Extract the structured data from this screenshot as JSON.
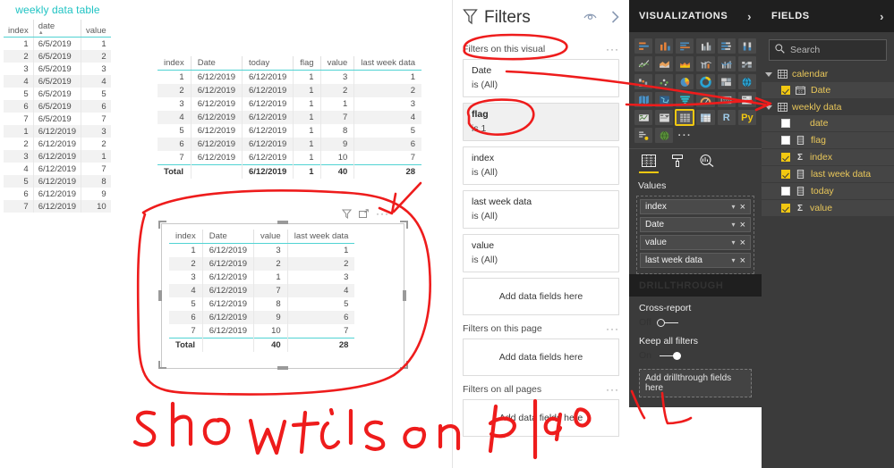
{
  "canvas": {
    "weekly_visual": {
      "title": "weekly data table",
      "columns": [
        "index",
        "date",
        "value"
      ],
      "sorted_column": "date",
      "rows": [
        [
          "1",
          "6/5/2019",
          "1"
        ],
        [
          "2",
          "6/5/2019",
          "2"
        ],
        [
          "3",
          "6/5/2019",
          "3"
        ],
        [
          "4",
          "6/5/2019",
          "4"
        ],
        [
          "5",
          "6/5/2019",
          "5"
        ],
        [
          "6",
          "6/5/2019",
          "6"
        ],
        [
          "7",
          "6/5/2019",
          "7"
        ],
        [
          "1",
          "6/12/2019",
          "3"
        ],
        [
          "2",
          "6/12/2019",
          "2"
        ],
        [
          "3",
          "6/12/2019",
          "1"
        ],
        [
          "4",
          "6/12/2019",
          "7"
        ],
        [
          "5",
          "6/12/2019",
          "8"
        ],
        [
          "6",
          "6/12/2019",
          "9"
        ],
        [
          "7",
          "6/12/2019",
          "10"
        ]
      ]
    },
    "detail_visual": {
      "columns": [
        "index",
        "Date",
        "today",
        "flag",
        "value",
        "last week data"
      ],
      "rows": [
        [
          "1",
          "6/12/2019",
          "6/12/2019",
          "1",
          "3",
          "1"
        ],
        [
          "2",
          "6/12/2019",
          "6/12/2019",
          "1",
          "2",
          "2"
        ],
        [
          "3",
          "6/12/2019",
          "6/12/2019",
          "1",
          "1",
          "3"
        ],
        [
          "4",
          "6/12/2019",
          "6/12/2019",
          "1",
          "7",
          "4"
        ],
        [
          "5",
          "6/12/2019",
          "6/12/2019",
          "1",
          "8",
          "5"
        ],
        [
          "6",
          "6/12/2019",
          "6/12/2019",
          "1",
          "9",
          "6"
        ],
        [
          "7",
          "6/12/2019",
          "6/12/2019",
          "1",
          "10",
          "7"
        ]
      ],
      "total": [
        "Total",
        "",
        "6/12/2019",
        "1",
        "40",
        "28"
      ]
    },
    "selected_visual": {
      "columns": [
        "index",
        "Date",
        "value",
        "last week data"
      ],
      "rows": [
        [
          "1",
          "6/12/2019",
          "3",
          "1"
        ],
        [
          "2",
          "6/12/2019",
          "2",
          "2"
        ],
        [
          "3",
          "6/12/2019",
          "1",
          "3"
        ],
        [
          "4",
          "6/12/2019",
          "7",
          "4"
        ],
        [
          "5",
          "6/12/2019",
          "8",
          "5"
        ],
        [
          "6",
          "6/12/2019",
          "9",
          "6"
        ],
        [
          "7",
          "6/12/2019",
          "10",
          "7"
        ]
      ],
      "total": [
        "Total",
        "",
        "40",
        "28"
      ],
      "toolbar": {
        "filter_icon": "filter-icon",
        "focus_icon": "focus-mode-icon",
        "more_label": "···"
      }
    }
  },
  "filters": {
    "title": "Filters",
    "filter_icon": "funnel-icon",
    "hide_icon": "eye-hide-icon",
    "collapse_icon": "chevron-right-icon",
    "more_label": "···",
    "visual_section": {
      "label": "Filters on this visual",
      "cards": [
        {
          "name": "Date",
          "value": "is (All)",
          "active": false
        },
        {
          "name": "flag",
          "value": "is 1",
          "active": true
        },
        {
          "name": "index",
          "value": "is (All)",
          "active": false
        },
        {
          "name": "last week data",
          "value": "is (All)",
          "active": false
        },
        {
          "name": "value",
          "value": "is (All)",
          "active": false
        }
      ],
      "dropzone": "Add data fields here"
    },
    "page_section": {
      "label": "Filters on this page",
      "dropzone": "Add data fields here"
    },
    "all_pages_section": {
      "label": "Filters on all pages",
      "dropzone": "Add data fields here"
    }
  },
  "visualizations": {
    "title": "VISUALIZATIONS",
    "collapse_icon": "chevron-right-icon",
    "icons": [
      {
        "name": "stacked-bar-chart-icon",
        "selected": false
      },
      {
        "name": "stacked-column-chart-icon",
        "selected": false
      },
      {
        "name": "clustered-bar-chart-icon",
        "selected": false
      },
      {
        "name": "clustered-column-chart-icon",
        "selected": false
      },
      {
        "name": "100-stacked-bar-chart-icon",
        "selected": false
      },
      {
        "name": "100-stacked-column-chart-icon",
        "selected": false
      },
      {
        "name": "line-chart-icon",
        "selected": false
      },
      {
        "name": "area-chart-icon",
        "selected": false
      },
      {
        "name": "stacked-area-chart-icon",
        "selected": false
      },
      {
        "name": "line-stacked-column-chart-icon",
        "selected": false
      },
      {
        "name": "line-clustered-column-chart-icon",
        "selected": false
      },
      {
        "name": "ribbon-chart-icon",
        "selected": false
      },
      {
        "name": "waterfall-chart-icon",
        "selected": false
      },
      {
        "name": "scatter-chart-icon",
        "selected": false
      },
      {
        "name": "pie-chart-icon",
        "selected": false
      },
      {
        "name": "donut-chart-icon",
        "selected": false
      },
      {
        "name": "treemap-icon",
        "selected": false
      },
      {
        "name": "map-icon",
        "selected": false
      },
      {
        "name": "filled-map-icon",
        "selected": false
      },
      {
        "name": "shape-map-icon",
        "selected": false
      },
      {
        "name": "funnel-chart-icon",
        "selected": false
      },
      {
        "name": "gauge-icon",
        "selected": false
      },
      {
        "name": "card-icon",
        "selected": false
      },
      {
        "name": "multi-row-card-icon",
        "selected": false
      },
      {
        "name": "kpi-icon",
        "selected": false
      },
      {
        "name": "slicer-icon",
        "selected": false
      },
      {
        "name": "table-icon",
        "selected": true
      },
      {
        "name": "matrix-icon",
        "selected": false
      },
      {
        "name": "r-script-visual-icon",
        "selected": false,
        "text": "R"
      },
      {
        "name": "python-visual-icon",
        "selected": false,
        "text": "Py"
      },
      {
        "name": "key-influencers-icon",
        "selected": false
      },
      {
        "name": "arcgis-maps-icon",
        "selected": false
      },
      {
        "name": "get-more-visuals-icon",
        "selected": false,
        "text": "···"
      }
    ],
    "tabs": [
      {
        "name": "fields-tab",
        "icon": "fields-grid-icon",
        "active": true
      },
      {
        "name": "format-tab",
        "icon": "paint-roller-icon",
        "active": false
      },
      {
        "name": "analytics-tab",
        "icon": "magnifier-chart-icon",
        "active": false
      }
    ],
    "values_well": {
      "label": "Values",
      "fields": [
        {
          "name": "index",
          "chevron": "▾",
          "remove": "×"
        },
        {
          "name": "Date",
          "chevron": "▾",
          "remove": "×"
        },
        {
          "name": "value",
          "chevron": "▾",
          "remove": "×"
        },
        {
          "name": "last week data",
          "chevron": "▾",
          "remove": "×"
        }
      ]
    }
  },
  "drillthrough": {
    "title": "DRILLTHROUGH",
    "cross_report": {
      "label": "Cross-report",
      "state": "Off",
      "on": false
    },
    "keep_all_filters": {
      "label": "Keep all filters",
      "state": "On",
      "on": true
    },
    "dropzone": "Add drillthrough fields here"
  },
  "fields": {
    "title": "FIELDS",
    "collapse_icon": "chevron-right-icon",
    "search": {
      "placeholder": "Search",
      "value": "",
      "icon": "search-icon"
    },
    "tables": [
      {
        "name": "calendar",
        "expanded": true,
        "fields": [
          {
            "name": "Date",
            "checked": true,
            "type": "date",
            "aggregate": false
          }
        ]
      },
      {
        "name": "weekly data",
        "expanded": true,
        "fields": [
          {
            "name": "date",
            "checked": false,
            "type": "plain",
            "aggregate": false
          },
          {
            "name": "flag",
            "checked": false,
            "type": "column",
            "aggregate": false
          },
          {
            "name": "index",
            "checked": true,
            "type": "sigma",
            "aggregate": true
          },
          {
            "name": "last week data",
            "checked": true,
            "type": "column",
            "aggregate": false
          },
          {
            "name": "today",
            "checked": false,
            "type": "column",
            "aggregate": false
          },
          {
            "name": "value",
            "checked": true,
            "type": "sigma",
            "aggregate": true
          }
        ]
      }
    ]
  },
  "annotations": {
    "handwriting": "show this on report",
    "color": "#ee1c1c",
    "marks": [
      {
        "name": "ellipse-filters-on-this-visual"
      },
      {
        "name": "ellipse-flag-filter"
      },
      {
        "name": "arrow-date-filter-to-fields-date"
      },
      {
        "name": "arrow-to-visual-more-menu"
      },
      {
        "name": "rectangle-around-selected-table"
      },
      {
        "name": "underline-drillthrough"
      }
    ]
  },
  "colors": {
    "accent_teal": "#1fc3c3",
    "panel_dark": "#3b3b3b",
    "panel_header_dark": "#1f1f1f",
    "field_yellow": "#e9c75a",
    "select_yellow": "#f2c811",
    "annotation_red": "#ee1c1c"
  }
}
